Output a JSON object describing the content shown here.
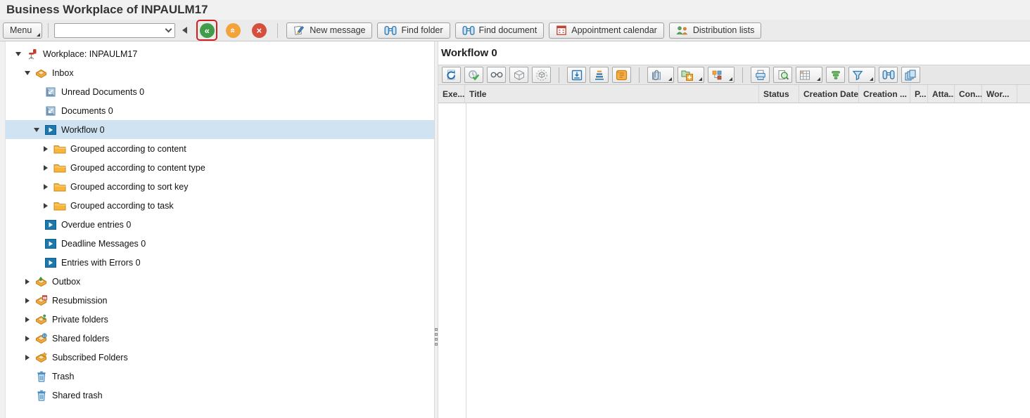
{
  "window": {
    "title": "Business Workplace of INPAULM17"
  },
  "toolbar": {
    "menu_label": "Menu",
    "command_value": "",
    "nav_buttons": [
      {
        "name": "back",
        "color": "#3f9d49",
        "highlighted": true
      },
      {
        "name": "exit",
        "color": "#f2a33a",
        "highlighted": false
      },
      {
        "name": "cancel",
        "color": "#d64f3d",
        "highlighted": false
      }
    ],
    "buttons": [
      {
        "name": "new-message",
        "label": "New message",
        "icon": "new-message"
      },
      {
        "name": "find-folder",
        "label": "Find folder",
        "icon": "find-folder"
      },
      {
        "name": "find-document",
        "label": "Find document",
        "icon": "find-document"
      },
      {
        "name": "appointment-calendar",
        "label": "Appointment calendar",
        "icon": "appointment-calendar"
      },
      {
        "name": "distribution-lists",
        "label": "Distribution lists",
        "icon": "distribution-lists"
      }
    ]
  },
  "tree": {
    "items": [
      {
        "label": "Workplace: INPAULM17",
        "level": 0,
        "expand": "open",
        "icon": "workplace",
        "selected": false
      },
      {
        "label": "Inbox",
        "level": 1,
        "expand": "open",
        "icon": "inbox",
        "selected": false
      },
      {
        "label": "Unread Documents 0",
        "level": 2,
        "expand": "none",
        "icon": "document",
        "selected": false
      },
      {
        "label": "Documents 0",
        "level": 2,
        "expand": "none",
        "icon": "document",
        "selected": false
      },
      {
        "label": "Workflow 0",
        "level": 2,
        "expand": "open",
        "icon": "workflow",
        "selected": true
      },
      {
        "label": "Grouped according to content",
        "level": 3,
        "expand": "closed",
        "icon": "folder",
        "selected": false
      },
      {
        "label": "Grouped according to content type",
        "level": 3,
        "expand": "closed",
        "icon": "folder",
        "selected": false
      },
      {
        "label": "Grouped according to sort key",
        "level": 3,
        "expand": "closed",
        "icon": "folder",
        "selected": false
      },
      {
        "label": "Grouped according to task",
        "level": 3,
        "expand": "closed",
        "icon": "folder",
        "selected": false
      },
      {
        "label": "Overdue entries 0",
        "level": 2,
        "expand": "none",
        "icon": "workflow",
        "selected": false
      },
      {
        "label": "Deadline Messages 0",
        "level": 2,
        "expand": "none",
        "icon": "workflow",
        "selected": false
      },
      {
        "label": "Entries with Errors 0",
        "level": 2,
        "expand": "none",
        "icon": "workflow",
        "selected": false
      },
      {
        "label": "Outbox",
        "level": 1,
        "expand": "closed",
        "icon": "outbox",
        "selected": false
      },
      {
        "label": "Resubmission",
        "level": 1,
        "expand": "closed",
        "icon": "resubmission",
        "selected": false
      },
      {
        "label": "Private folders",
        "level": 1,
        "expand": "closed",
        "icon": "private-folders",
        "selected": false
      },
      {
        "label": "Shared folders",
        "level": 1,
        "expand": "closed",
        "icon": "shared-folders",
        "selected": false
      },
      {
        "label": "Subscribed Folders",
        "level": 1,
        "expand": "closed",
        "icon": "subscribed-folders",
        "selected": false
      },
      {
        "label": "Trash",
        "level": 1,
        "expand": "none",
        "icon": "trash",
        "selected": false
      },
      {
        "label": "Shared trash",
        "level": 1,
        "expand": "none",
        "icon": "trash",
        "selected": false
      }
    ]
  },
  "workflow_panel": {
    "title": "Workflow 0",
    "toolbar_groups": [
      [
        {
          "icon": "refresh"
        },
        {
          "icon": "execute"
        },
        {
          "icon": "glasses"
        },
        {
          "icon": "cube"
        },
        {
          "icon": "cube-dotted"
        }
      ],
      [
        {
          "icon": "forward"
        },
        {
          "icon": "priority"
        },
        {
          "icon": "log"
        }
      ],
      [
        {
          "icon": "attach",
          "dropdown": true
        },
        {
          "icon": "create",
          "dropdown": true
        },
        {
          "icon": "blocks",
          "dropdown": true
        }
      ],
      [
        {
          "icon": "print"
        },
        {
          "icon": "preview"
        },
        {
          "icon": "table-view",
          "dropdown": true
        },
        {
          "icon": "sort"
        },
        {
          "icon": "filter",
          "dropdown": true
        },
        {
          "icon": "binoculars"
        },
        {
          "icon": "layers"
        }
      ]
    ],
    "columns": [
      "Exe...",
      "Title",
      "Status",
      "Creation Date",
      "Creation ...",
      "P...",
      "Atta...",
      "Con...",
      "Wor..."
    ]
  },
  "colors": {
    "selection": "#cfe3f2",
    "focus_highlight": "#cf1f1f",
    "accent_blue": "#1c79ae",
    "folder_orange": "#f9b43a"
  }
}
